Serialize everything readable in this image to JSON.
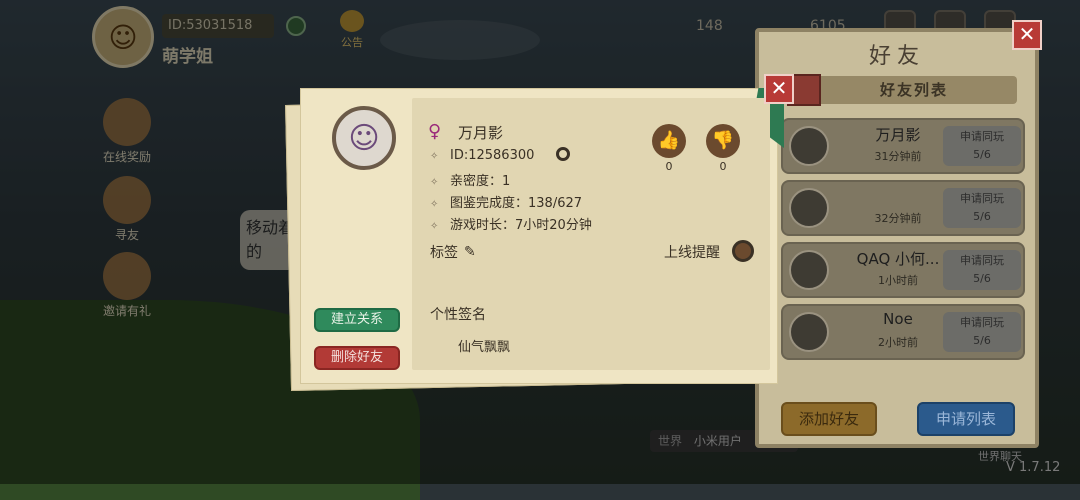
{
  "hud": {
    "player_id": "ID:53031518",
    "player_name": "萌学姐",
    "notice_label": "公告",
    "diamonds": "148",
    "coins": "6105"
  },
  "side_menu": [
    {
      "label": "在线奖励"
    },
    {
      "label": "寻友"
    },
    {
      "label": "邀请有礼"
    }
  ],
  "chat_bubble": "移动着的",
  "world_chat": {
    "channel": "世界",
    "text": "小米用户"
  },
  "world_room": "世界聊天",
  "version": "V 1.7.12",
  "friends_panel": {
    "title": "好友",
    "tab_label": "好友列表",
    "friends": [
      {
        "name": "万月影",
        "time": "31分钟前",
        "button": "申请同玩",
        "count": "5/6"
      },
      {
        "name": "",
        "time": "32分钟前",
        "button": "申请同玩",
        "count": "5/6"
      },
      {
        "name": "QAQ 小何...",
        "time": "1小时前",
        "button": "申请同玩",
        "count": "5/6"
      },
      {
        "name": "Noe",
        "time": "2小时前",
        "button": "申请同玩",
        "count": "5/6"
      }
    ],
    "add_friend": "添加好友",
    "request_list": "申请列表"
  },
  "profile": {
    "name": "万月影",
    "id": "ID:12586300",
    "intimacy": "亲密度：1",
    "collection": "图鉴完成度：138/627",
    "playtime": "游戏时长：7小时20分钟",
    "likes": "0",
    "dislikes": "0",
    "tag_label": "标签",
    "online_reminder": "上线提醒",
    "build_relation": "建立关系",
    "delete_friend": "删除好友",
    "signature_label": "个性签名",
    "signature": "仙气飘飘"
  }
}
